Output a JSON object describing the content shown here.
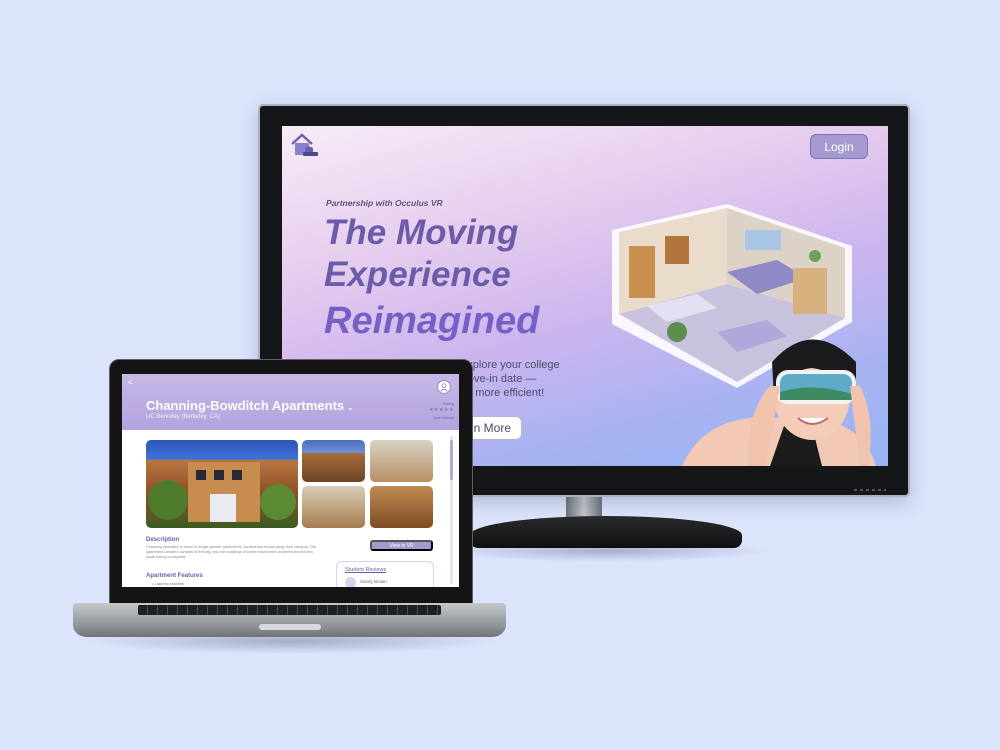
{
  "colors": {
    "background": "#dbe4fb",
    "accent": "#a49ad0",
    "hero_text": "#6a5ca8",
    "header": "#b3a3de"
  },
  "monitor": {
    "logo_icon": "house-logo-icon",
    "login_label": "Login",
    "partner_text": "Partnership with Occulus VR",
    "hero": {
      "line1": "The Moving",
      "line2": "Experience",
      "line3": "Reimagined"
    },
    "subtitle_lines": [
      "o explore your college",
      "r move-in date —",
      "king more efficient!"
    ],
    "cta_label": "n More"
  },
  "laptop": {
    "back_icon": "back-arrow-icon",
    "title": "Channing-Bowditch Apartments",
    "title_chevron": "⌄",
    "location": "UC Berkeley (Berkeley, CA)",
    "profile_icon": "profile-icon",
    "rating": {
      "label": "Rating",
      "stars": "★★★★★",
      "count": "(see below)"
    },
    "description": {
      "heading": "Description",
      "text": "Channing-Bowditch is home to single-gender apartments, located two blocks away from campus. The apartment complex consists of friendly, low-rise buildings of warm wood tones clustered around two south facing courtyards."
    },
    "view_vr_label": "View in VR",
    "features": {
      "heading": "Apartment Features",
      "items": [
        "• Laundry facilities"
      ]
    },
    "reviews": {
      "heading": "Student Reviews",
      "first_name": "Sandy Brown"
    }
  }
}
